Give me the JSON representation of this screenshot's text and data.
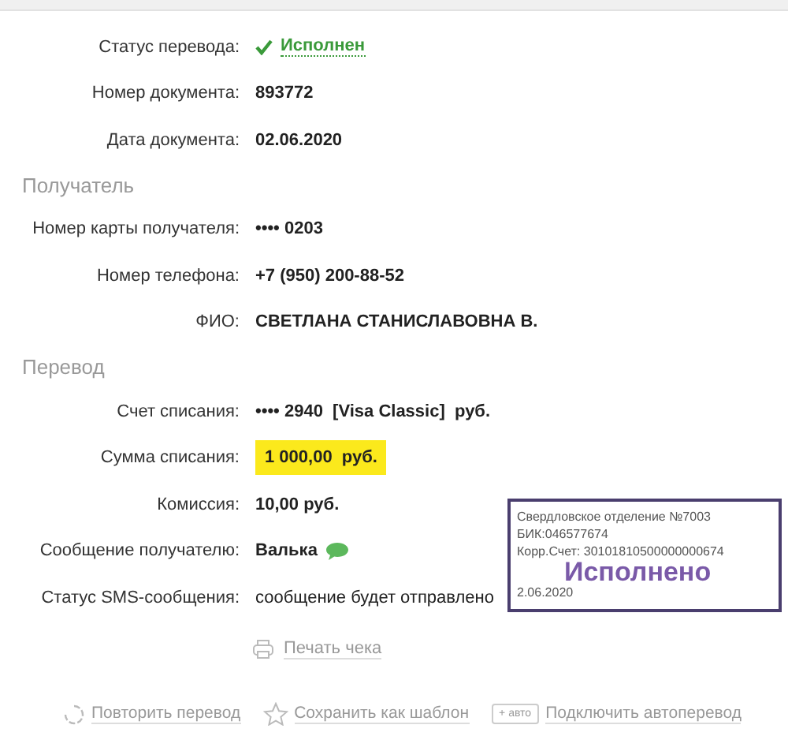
{
  "sections": [
    {
      "rows": [
        {
          "label": "Статус перевода:",
          "value": "Исполнен",
          "kind": "status"
        },
        {
          "label": "Номер документа:",
          "value": "893772",
          "kind": "bold"
        },
        {
          "label": "Дата документа:",
          "value": "02.06.2020",
          "kind": "bold"
        }
      ]
    },
    {
      "title": "Получатель",
      "rows": [
        {
          "label": "Номер карты получателя:",
          "value": "•••• 0203",
          "kind": "bold"
        },
        {
          "label": "Номер телефона:",
          "value": "+7 (950) 200-88-52",
          "kind": "bold"
        },
        {
          "label": "ФИО:",
          "value": "СВЕТЛАНА СТАНИСЛАВОВНА В.",
          "kind": "bold"
        }
      ]
    },
    {
      "title": "Перевод",
      "rows": [
        {
          "label": "Счет списания:",
          "value": "•••• 2940  [Visa Classic]  руб.",
          "kind": "bold"
        },
        {
          "label": "Сумма списания:",
          "value": "1 000,00  руб.",
          "kind": "highlight"
        },
        {
          "label": "Комиссия:",
          "value": "10,00 руб.",
          "kind": "bold"
        },
        {
          "label": "Сообщение получателю:",
          "value": "Валька",
          "kind": "message"
        },
        {
          "label": "Статус SMS-сообщения:",
          "value": "сообщение будет отправлено",
          "kind": "plain"
        }
      ]
    }
  ],
  "print_link": "Печать чека",
  "actions": [
    {
      "label": "Повторить перевод",
      "kind": "repeat"
    },
    {
      "label": "Сохранить как шаблон",
      "kind": "star"
    },
    {
      "label": "Подключить автоперевод",
      "kind": "auto",
      "badge": "+ авто"
    }
  ],
  "stamp": {
    "lines": [
      "Свердловское отделение №7003",
      "БИК:046577674",
      "Корр.Счет: 30101810500000000674"
    ],
    "status": "Исполнено",
    "date": "2.06.2020"
  }
}
